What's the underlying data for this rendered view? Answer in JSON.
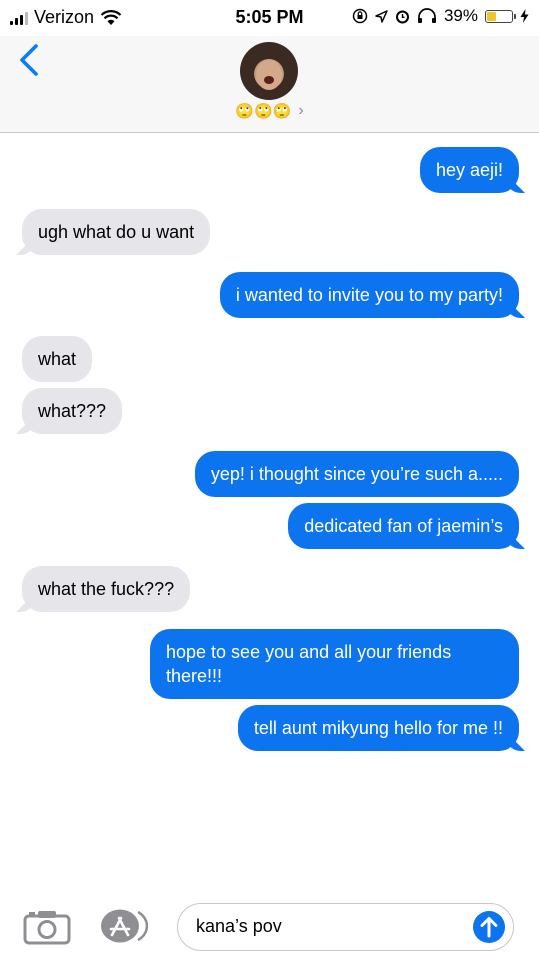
{
  "status_bar": {
    "carrier": "Verizon",
    "time": "5:05 PM",
    "battery_percent": "39%",
    "battery_level": 0.39
  },
  "header": {
    "contact_emojis": "🙄🙄🙄",
    "chevron": "›"
  },
  "messages": [
    {
      "side": "sent",
      "text": "hey aeji!"
    },
    {
      "side": "received",
      "text": "ugh what do u want"
    },
    {
      "side": "sent",
      "text": "i wanted to invite you to my party!"
    },
    {
      "side": "received",
      "text": "what"
    },
    {
      "side": "received",
      "text": "what???"
    },
    {
      "side": "sent",
      "text": "yep! i thought since you’re such a....."
    },
    {
      "side": "sent",
      "text": "dedicated fan of jaemin’s"
    },
    {
      "side": "received",
      "text": "what the fuck???"
    },
    {
      "side": "sent",
      "text": "hope to see you and all your friends there!!!"
    },
    {
      "side": "sent",
      "text": "tell aunt mikyung hello for me !!"
    }
  ],
  "composer": {
    "input_value": "kana’s pov"
  },
  "colors": {
    "sent_bubble": "#0b74ee",
    "received_bubble": "#e5e5ea",
    "ios_blue": "#0a7aff"
  }
}
